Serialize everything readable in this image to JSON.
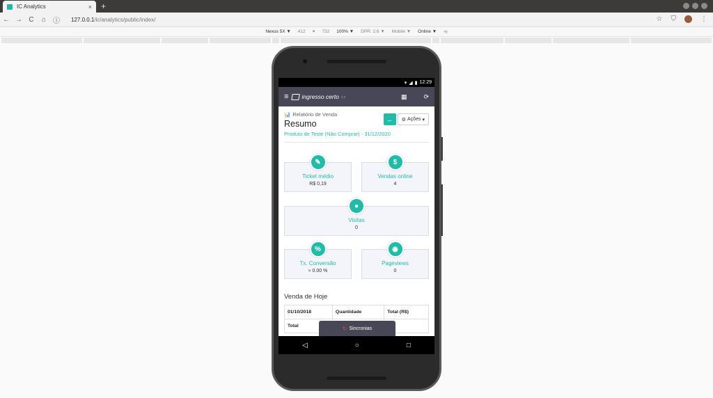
{
  "browser": {
    "tab_title": "IC Analytics",
    "tab_close": "×",
    "new_tab": "+",
    "url_host": "127.0.0.1",
    "url_path": "/ic/analytics/public/index/",
    "back": "←",
    "forward": "→",
    "reload": "C",
    "home": "⌂"
  },
  "devtools": {
    "device": "Nexus 5X ▼",
    "width": "412",
    "x": "×",
    "height": "732",
    "zoom": "100% ▼",
    "dpr": "DPR: 2.6 ▼",
    "mode": "Mobile ▼",
    "network": "Online ▼"
  },
  "phone": {
    "time": "12:29",
    "app_name": "ingresso certo",
    "app_version": "2.0",
    "report_label": "Relatório de Venda",
    "title": "Resumo",
    "subtitle": "Produto de Teste (Não Comprar) - 31/12/2020",
    "actions_label": "Ações",
    "cards": [
      {
        "label": "Ticket médio",
        "value": "R$ 0,19",
        "icon": "ticket-icon"
      },
      {
        "label": "Vendas online",
        "value": "4",
        "icon": "dollar-icon"
      },
      {
        "label": "Visitas",
        "value": "0",
        "icon": "user-icon"
      },
      {
        "label": "Tx. Conversão",
        "value": "≈ 0.00 %",
        "icon": "percent-icon"
      },
      {
        "label": "Pageviews",
        "value": "0",
        "icon": "eye-icon"
      }
    ],
    "today_title": "Venda de Hoje",
    "table": {
      "headers": [
        "01/10/2018",
        "Quantidade",
        "Total (R$)"
      ],
      "total_label": "Total"
    },
    "sync_label": "Sincronias"
  },
  "colors": {
    "accent": "#1fbda7",
    "appbar": "#474757"
  }
}
